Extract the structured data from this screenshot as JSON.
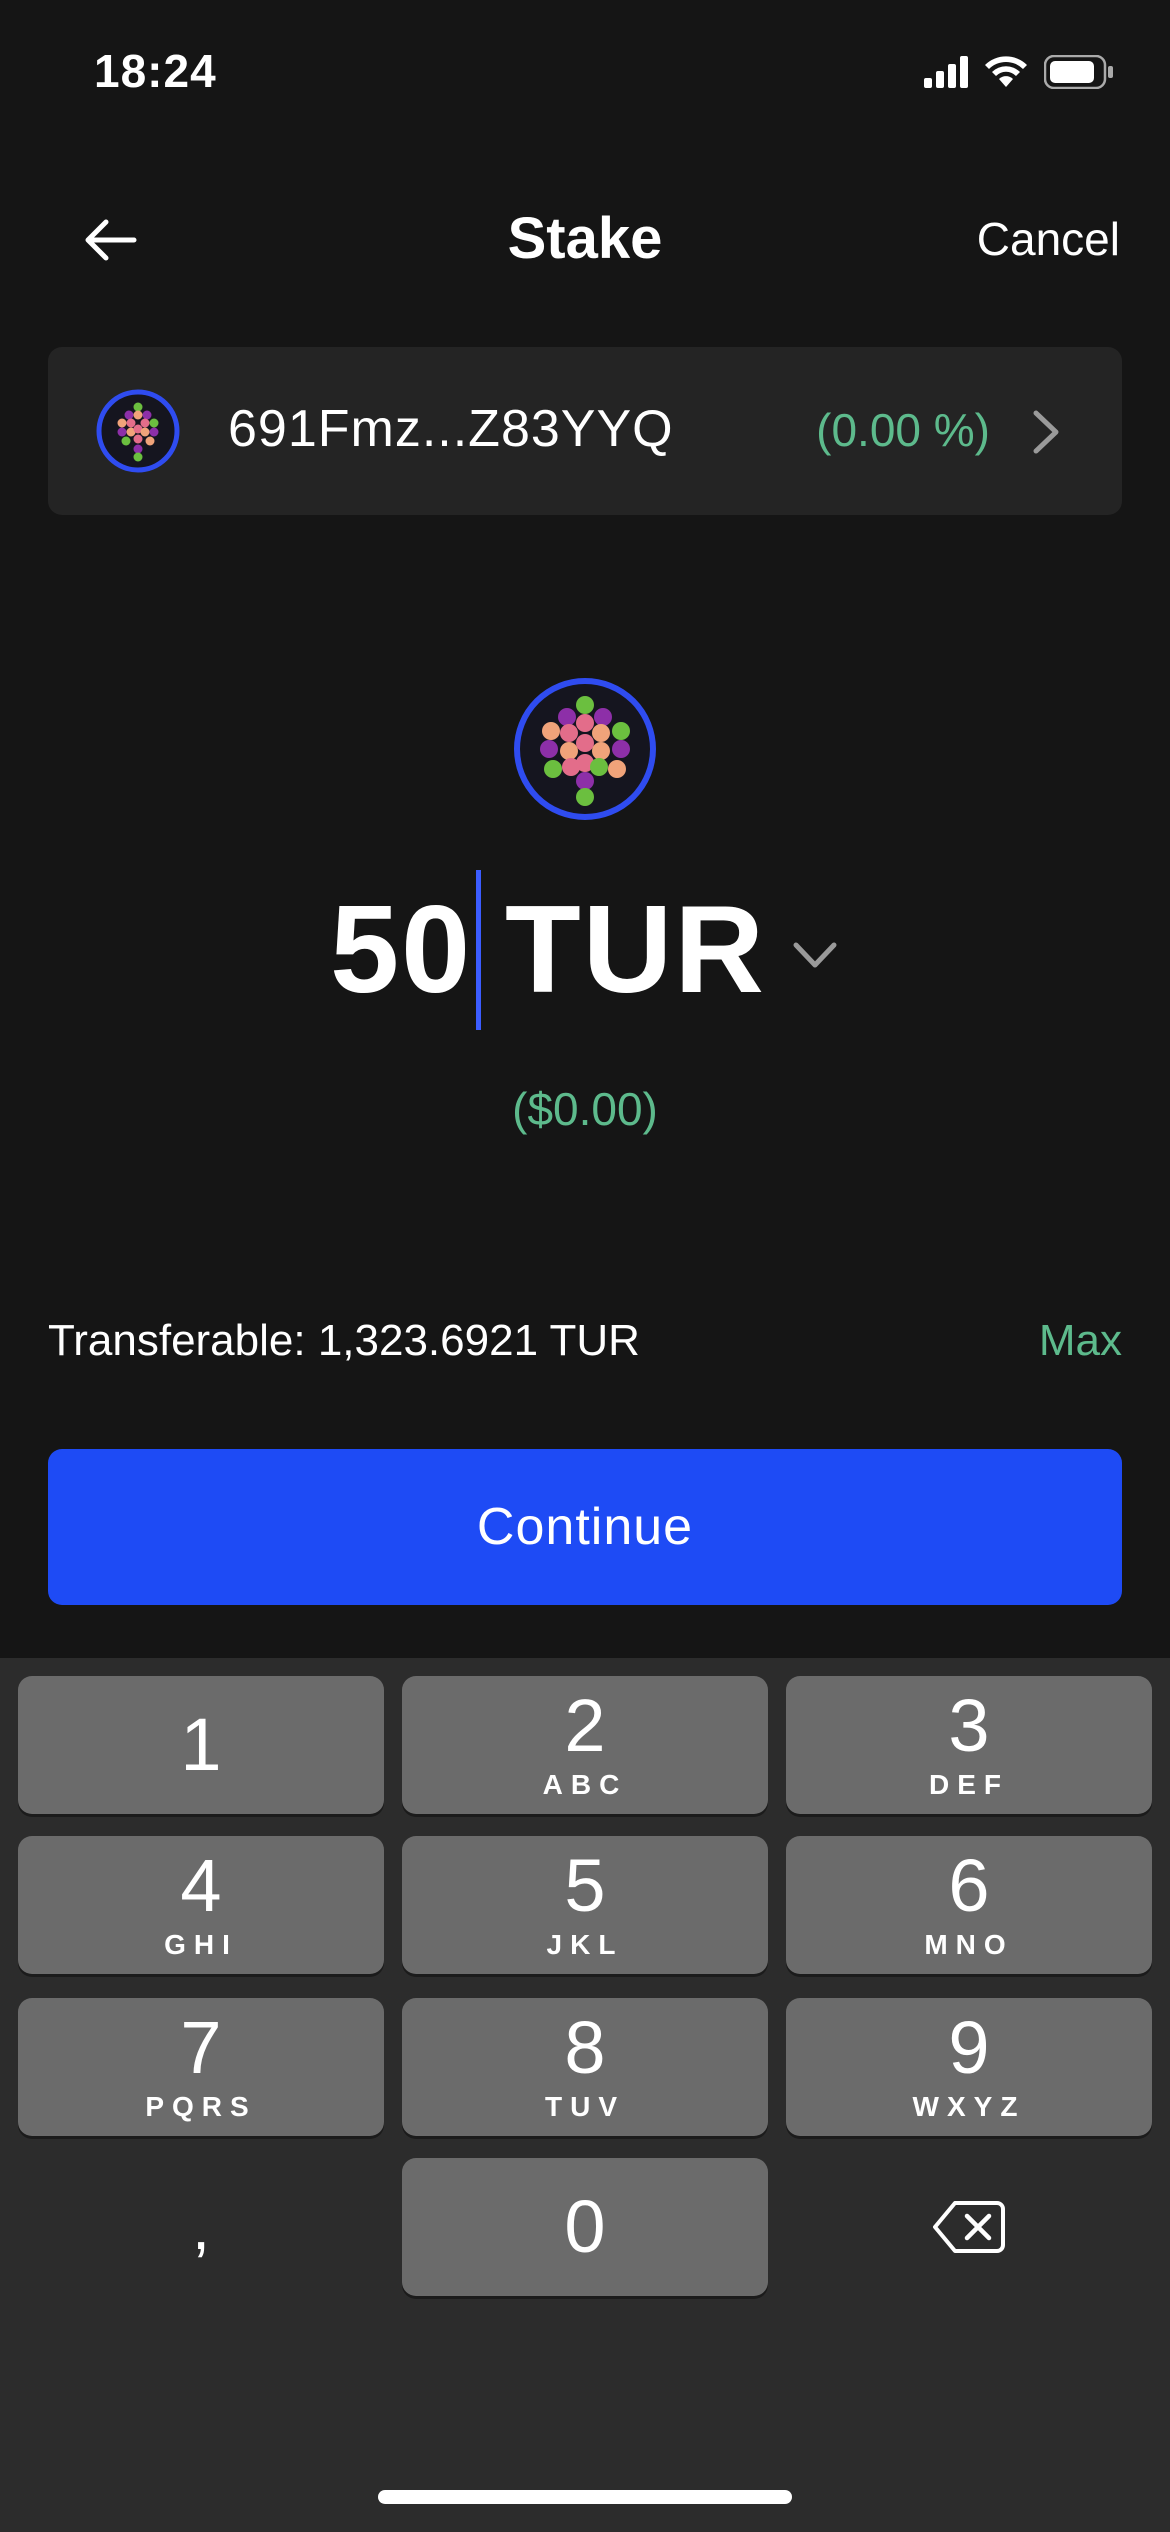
{
  "status_bar": {
    "time": "18:24",
    "icons": [
      "signal-icon",
      "wifi-icon",
      "battery-icon"
    ]
  },
  "header": {
    "back_icon": "arrow-left-icon",
    "title": "Stake",
    "cancel_label": "Cancel"
  },
  "validator": {
    "address": "691Fmz...Z83YYQ",
    "rate": "(0.00 %)",
    "chevron_icon": "chevron-right-icon"
  },
  "amount": {
    "value": "50",
    "symbol": "TUR",
    "fiat": "($0.00)",
    "dropdown_icon": "chevron-down-icon"
  },
  "transferable": {
    "text": "Transferable: 1,323.6921 TUR",
    "max_label": "Max"
  },
  "continue_label": "Continue",
  "keyboard": {
    "keys": [
      {
        "num": "1",
        "letters": ""
      },
      {
        "num": "2",
        "letters": "ABC"
      },
      {
        "num": "3",
        "letters": "DEF"
      },
      {
        "num": "4",
        "letters": "GHI"
      },
      {
        "num": "5",
        "letters": "JKL"
      },
      {
        "num": "6",
        "letters": "MNO"
      },
      {
        "num": "7",
        "letters": "PQRS"
      },
      {
        "num": "8",
        "letters": "TUV"
      },
      {
        "num": "9",
        "letters": "WXYZ"
      },
      {
        "num": "0",
        "letters": ""
      }
    ],
    "comma": ",",
    "delete_icon": "backspace-icon"
  },
  "colors": {
    "accent": "#1e4bf5",
    "positive": "#5dba8c",
    "background": "#151515",
    "card": "#242424",
    "key": "#6b6b6b"
  }
}
